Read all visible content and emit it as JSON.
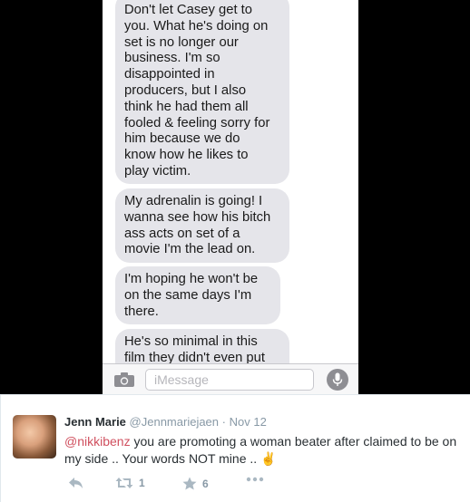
{
  "messages": [
    "Don't let Casey get to\nyou. What he's doing on\nset is no longer our\nbusiness. I'm so\ndisappointed in\nproducers, but I also\nthink he had them all\nfooled & feeling sorry for\nhim because we do\nknow how he likes to\nplay victim.",
    "My adrenalin is going! I\nwanna see how his bitch\nass acts on set of a\nmovie I'm the lead on.",
    "I'm hoping he won't be\non the same days I'm\nthere.",
    "He's so minimal in this\nfilm they didn't even put"
  ],
  "input": {
    "placeholder": "iMessage"
  },
  "tweet": {
    "author_name": "Jenn Marie",
    "author_handle": "@Jennmariejaen",
    "separator": "·",
    "time": "Nov 12",
    "mention": "@nikkibenz",
    "text": " you are promoting a woman beater after claimed to be on my side ..  Your words NOT mine .. ",
    "emoji": "✌",
    "retweets": "1",
    "favorites": "6"
  },
  "colors": {
    "bubble": "#e5e5ea",
    "mention": "#d0505f",
    "meta": "#8899a6"
  }
}
